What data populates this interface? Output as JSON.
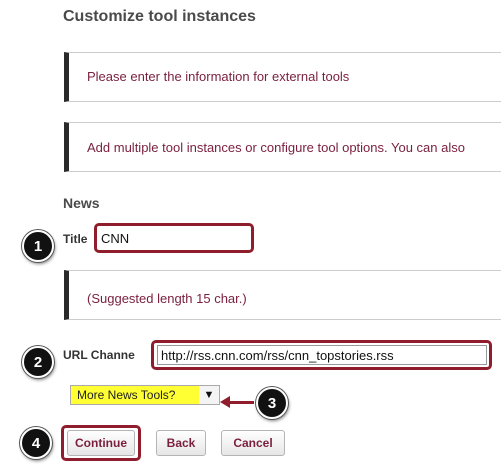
{
  "page_title": "Customize tool instances",
  "info_boxes": {
    "external_tools": "Please enter the information for external tools",
    "multiple_instances": "Add multiple tool instances or configure tool options. You can also"
  },
  "section": {
    "title": "News"
  },
  "fields": {
    "title": {
      "label": "Title",
      "value": "CNN"
    },
    "suggested_length": "(Suggested length 15 char.)",
    "url_channel": {
      "label": "URL Channe",
      "value": "http://rss.cnn.com/rss/cnn_topstories.rss"
    }
  },
  "more_tools": {
    "selected": "More News Tools?",
    "arrow_icon": "dropdown-arrow-icon"
  },
  "buttons": {
    "continue": "Continue",
    "back": "Back",
    "cancel": "Cancel"
  },
  "steps": [
    "1",
    "2",
    "3",
    "4"
  ],
  "colors": {
    "highlight": "#8f1d2c",
    "info_text": "#7a1f3d",
    "select_highlight": "#ffff33"
  }
}
